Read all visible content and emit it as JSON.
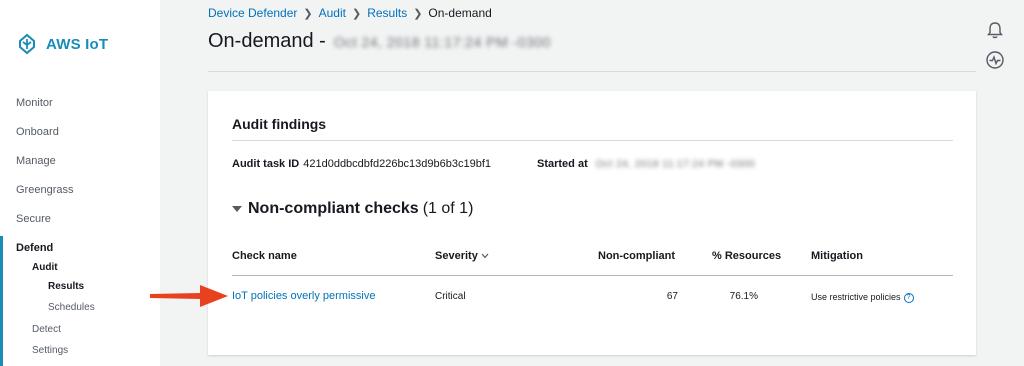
{
  "sidebar": {
    "logo_text": "AWS IoT",
    "items": {
      "monitor": "Monitor",
      "onboard": "Onboard",
      "manage": "Manage",
      "greengrass": "Greengrass",
      "secure": "Secure",
      "defend": "Defend",
      "audit": "Audit",
      "results": "Results",
      "schedules": "Schedules",
      "detect": "Detect",
      "settings": "Settings"
    }
  },
  "breadcrumb": {
    "device_defender": "Device Defender",
    "audit": "Audit",
    "results": "Results",
    "current": "On-demand"
  },
  "header": {
    "title": "On-demand -",
    "title_date": "Oct 24, 2018 11:17:24 PM -0300"
  },
  "card": {
    "title": "Audit findings",
    "task_id_label": "Audit task ID",
    "task_id_value": "421d0ddbcdbfd226bc13d9b6b3c19bf1",
    "started_label": "Started at",
    "started_value": "Oct 24, 2018 11:17:24 PM -0300",
    "section_title": "Non-compliant checks",
    "section_count": "(1 of 1)"
  },
  "table": {
    "headers": {
      "check_name": "Check name",
      "severity": "Severity",
      "non_compliant": "Non-compliant",
      "resources": "% Resources",
      "mitigation": "Mitigation"
    },
    "rows": [
      {
        "check_name": "IoT policies overly permissive",
        "severity": "Critical",
        "non_compliant": "67",
        "resources": "76.1%",
        "mitigation": "Use restrictive policies"
      }
    ]
  },
  "colors": {
    "accent": "#1a8cb8",
    "link": "#0073bb",
    "annotation_arrow": "#e8411f"
  }
}
